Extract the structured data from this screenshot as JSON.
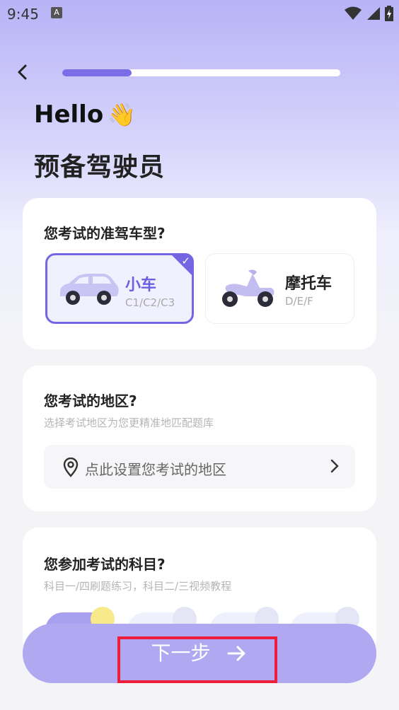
{
  "status_bar": {
    "time": "9:45",
    "badge": "A",
    "icons": [
      "wifi-icon",
      "signal-icon",
      "battery-icon"
    ]
  },
  "header": {
    "back_icon": "chevron-left-icon",
    "progress_fraction": 0.25
  },
  "greeting": {
    "hello": "Hello",
    "wave": "👋",
    "title": "预备驾驶员"
  },
  "vehicle_section": {
    "question": "您考试的准驾车型?",
    "options": [
      {
        "title": "小车",
        "sub": "C1/C2/C3",
        "icon": "car-icon",
        "selected": true
      },
      {
        "title": "摩托车",
        "sub": "D/E/F",
        "icon": "motorcycle-icon",
        "selected": false
      }
    ]
  },
  "region_section": {
    "question": "您考试的地区?",
    "hint": "选择考试地区为您更精准地匹配题库",
    "placeholder": "点此设置您考试的地区",
    "icon": "location-pin-icon"
  },
  "subject_section": {
    "question": "您参加考试的科目?",
    "hint": "科目一/四刷题练习，科目二/三视频教程"
  },
  "next_button": {
    "label": "下一步",
    "icon": "arrow-right-icon"
  },
  "colors": {
    "accent": "#7466e2",
    "highlight": "#ee1d3c"
  }
}
